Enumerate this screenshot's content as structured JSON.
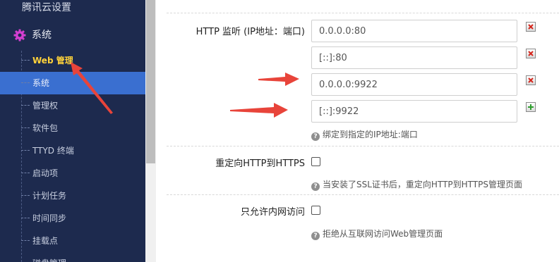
{
  "sidebar": {
    "top_title": "腾讯云设置",
    "group_label": "系统",
    "items": [
      {
        "label": "Web 管理"
      },
      {
        "label": "系统"
      },
      {
        "label": "管理权"
      },
      {
        "label": "软件包"
      },
      {
        "label": "TTYD 终端"
      },
      {
        "label": "启动项"
      },
      {
        "label": "计划任务"
      },
      {
        "label": "时间同步"
      },
      {
        "label": "挂载点"
      },
      {
        "label": "磁盘管理"
      }
    ]
  },
  "main": {
    "http_listen": {
      "label": "HTTP 监听 (IP地址：端口)",
      "values": [
        "0.0.0.0:80",
        "[::]:80",
        "0.0.0.0:9922",
        "[::]:9922"
      ],
      "hint": "绑定到指定的IP地址:端口"
    },
    "redirect": {
      "label": "重定向HTTP到HTTPS",
      "hint": "当安装了SSL证书后，重定向HTTP到HTTPS管理页面"
    },
    "intranet": {
      "label": "只允许内网访问",
      "hint": "拒绝从互联网访问Web管理页面"
    }
  },
  "colors": {
    "sidebar_bg": "#1d2a4e",
    "selected_text": "#ffd23a",
    "active_item_bg": "#3a6fd0",
    "annotation_arrow": "#e8443a"
  }
}
